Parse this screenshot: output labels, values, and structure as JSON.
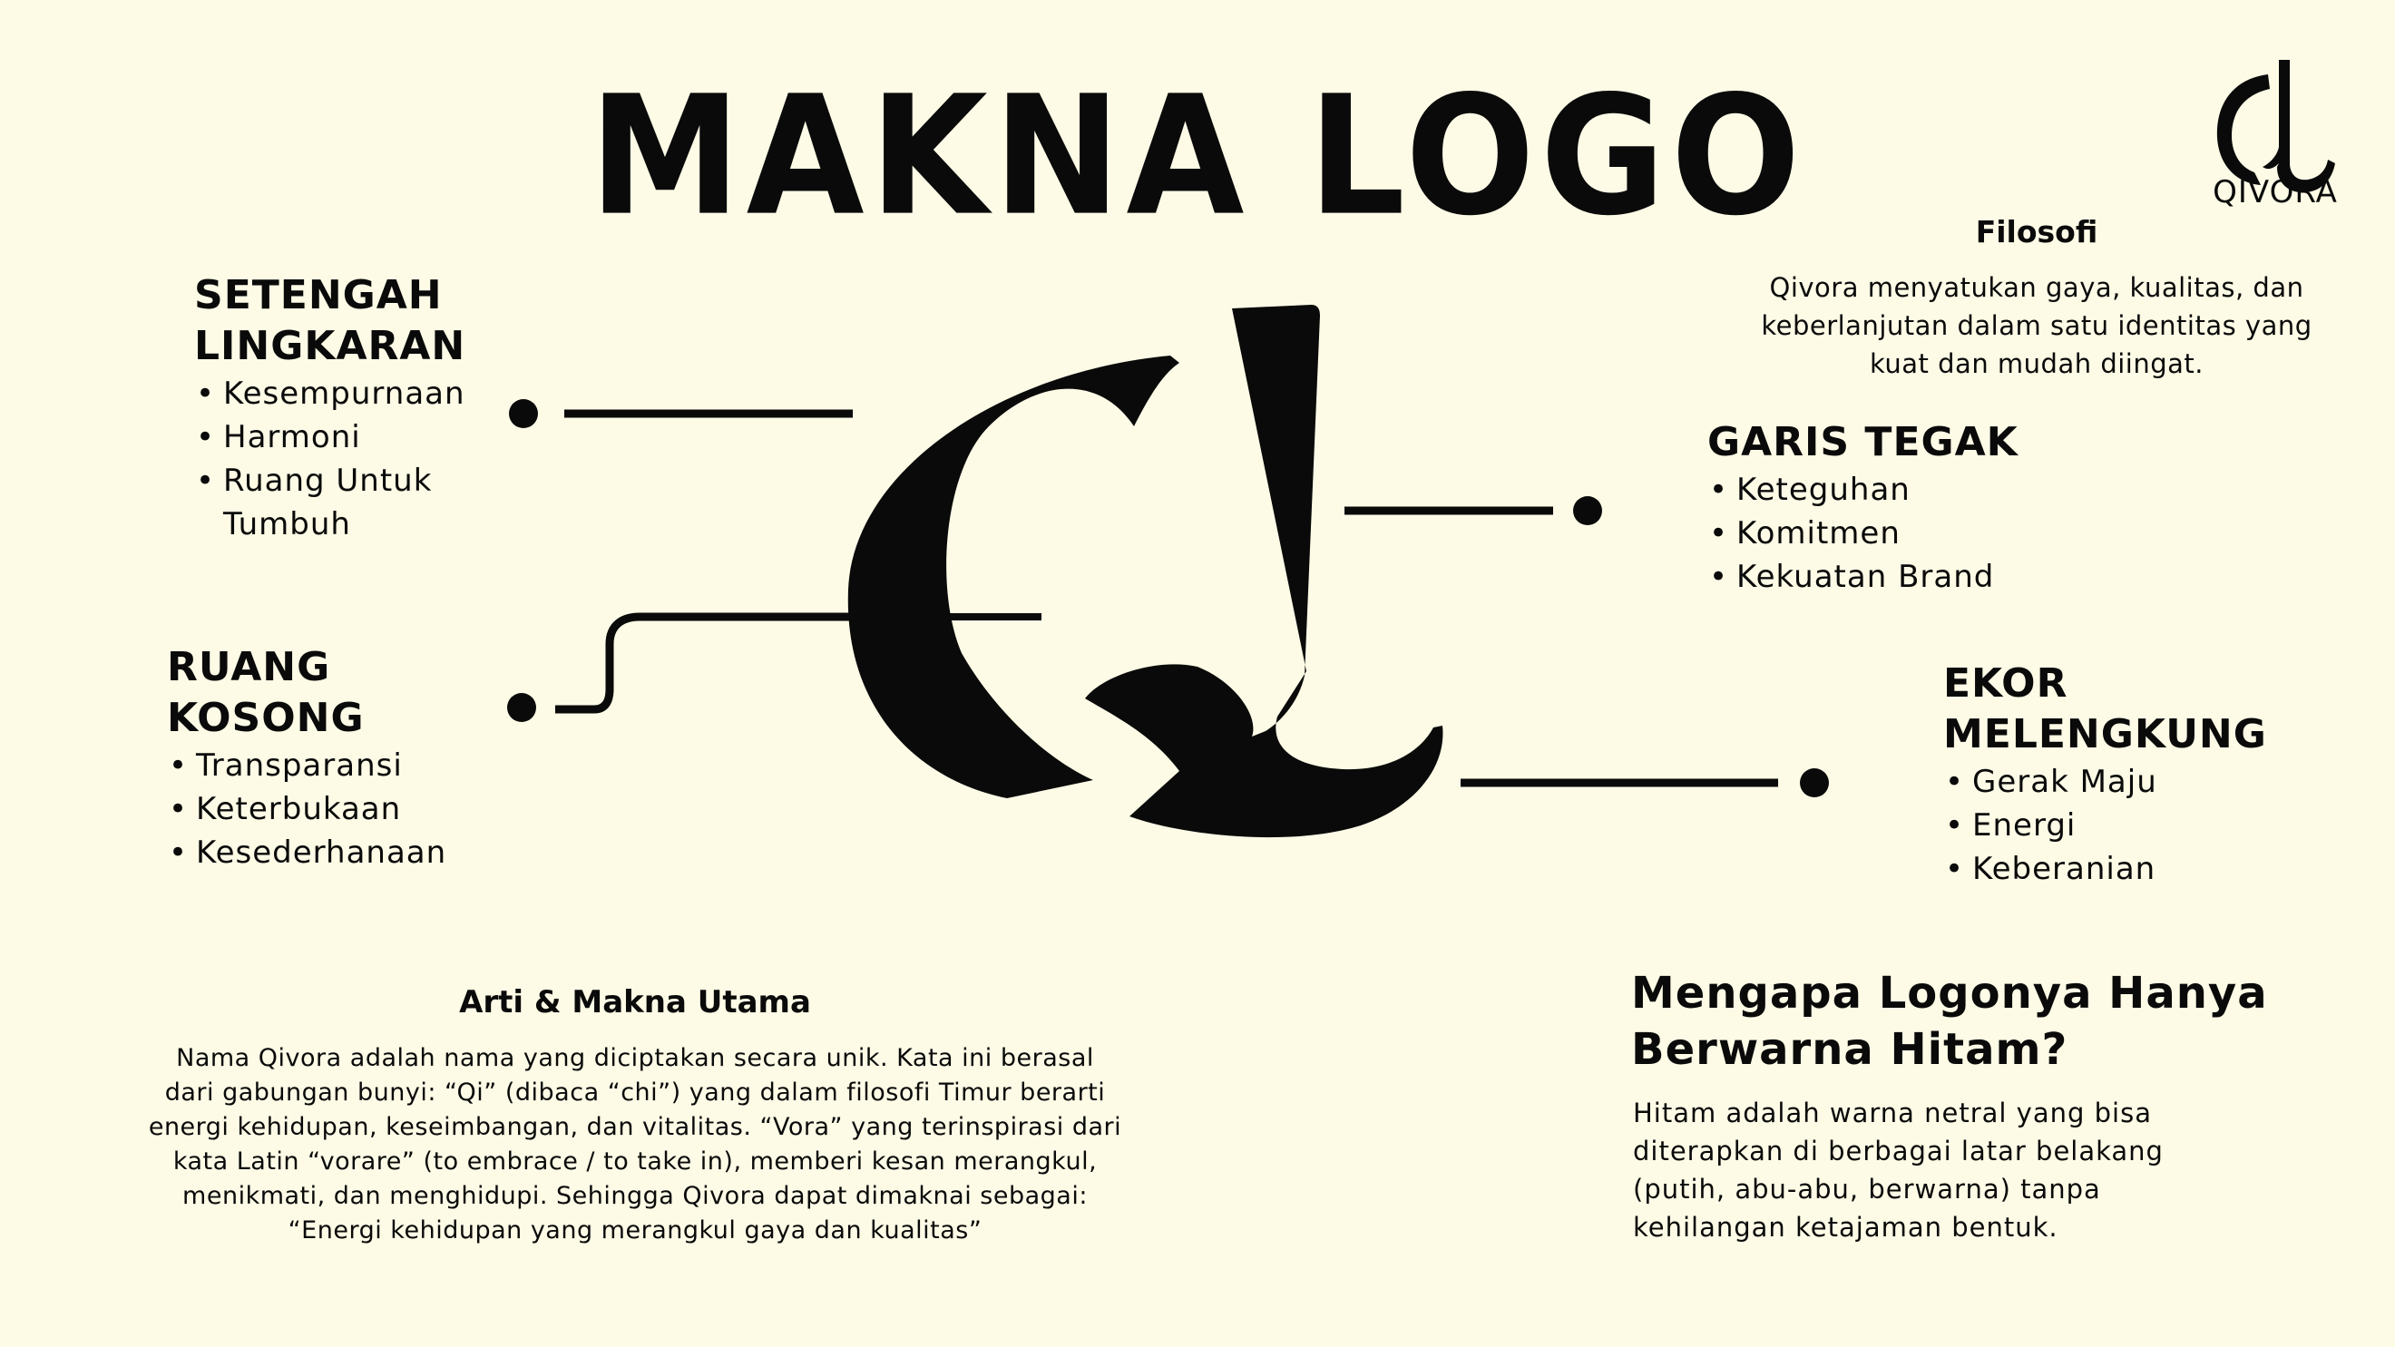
{
  "title": "MAKNA LOGO",
  "brand": {
    "name": "QIVORA",
    "mark_icon": "qivora-logo-icon"
  },
  "filosofi": {
    "heading": "Filosofi",
    "text": "Qivora menyatukan gaya, kualitas, dan keberlanjutan dalam satu identitas yang kuat dan mudah diingat."
  },
  "sections": {
    "setengah_lingkaran": {
      "heading_line1": "SETENGAH",
      "heading_line2": "LINGKARAN",
      "points": [
        "Kesempurnaan",
        "Harmoni",
        "Ruang Untuk Tumbuh"
      ]
    },
    "ruang_kosong": {
      "heading_line1": "RUANG",
      "heading_line2": "KOSONG",
      "points": [
        "Transparansi",
        "Keterbukaan",
        "Kesederhanaan"
      ]
    },
    "garis_tegak": {
      "heading": "GARIS TEGAK",
      "points": [
        "Keteguhan",
        "Komitmen",
        "Kekuatan Brand"
      ]
    },
    "ekor_melengkung": {
      "heading_line1": "EKOR",
      "heading_line2": "MELENGKUNG",
      "points": [
        "Gerak Maju",
        "Energi",
        "Keberanian"
      ]
    }
  },
  "arti": {
    "heading": "Arti & Makna Utama",
    "lines": [
      "Nama Qivora adalah nama yang diciptakan secara unik. Kata ini berasal",
      "dari gabungan bunyi: “Qi” (dibaca “chi”) yang dalam filosofi Timur berarti",
      "energi kehidupan, keseimbangan, dan vitalitas. “Vora” yang terinspirasi dari",
      "kata Latin “vorare” (to embrace / to take in), memberi kesan merangkul,",
      "menikmati, dan menghidupi. Sehingga Qivora dapat dimaknai sebagai:",
      "“Energi kehidupan yang merangkul gaya dan kualitas”"
    ]
  },
  "mengapa": {
    "heading_line1": "Mengapa Logonya Hanya",
    "heading_line2": "Berwarna Hitam?",
    "lines": [
      "Hitam adalah warna netral yang bisa",
      "diterapkan di berbagai latar belakang",
      "(putih, abu-abu, berwarna) tanpa",
      "kehilangan ketajaman bentuk."
    ]
  },
  "colors": {
    "background": "#fdfbe6",
    "ink": "#0a0a0a"
  }
}
